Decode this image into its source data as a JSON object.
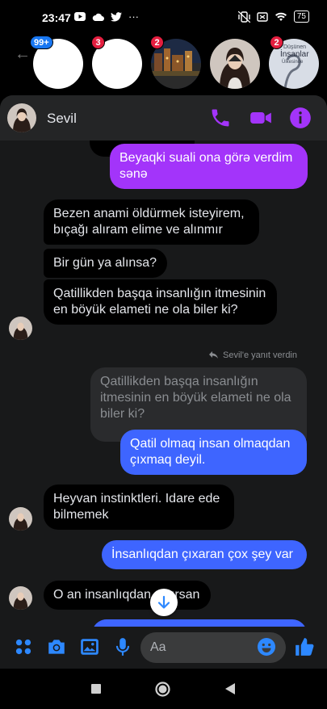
{
  "status_bar": {
    "time": "23:47",
    "dots": "···",
    "battery": "75"
  },
  "chat_heads": [
    {
      "badge": "99+",
      "badge_color": "#1877f2"
    },
    {
      "badge": "3",
      "badge_color": "#e41e3f"
    },
    {
      "badge": "2",
      "badge_color": "#e41e3f"
    },
    {
      "badge": "",
      "badge_color": ""
    },
    {
      "badge": "2",
      "badge_color": "#e41e3f",
      "art_text": [
        "Düşünen",
        "İnsanlar",
        "Ülkesinde"
      ]
    }
  ],
  "header": {
    "name": "Sevil"
  },
  "colors": {
    "accent": "#a334fa",
    "blue_bubble": "#3e65ff",
    "purple_bubble": "#a334fa",
    "icon_blue": "#2d88ff"
  },
  "messages": {
    "m0": "Beyaqki suali ona görə verdim sənə",
    "m1": "Bezen anami öldürmek isteyirem, bıçağı alıram elime ve alınmır",
    "m2": "Bir gün ya alınsa?",
    "m3": "Qatillikden başqa insanlığın itmesinin en böyük elameti ne ola biler ki?",
    "reply_note": "Sevil'e yanıt verdin",
    "m4_quoted": "Qatillikden başqa insanlığın itmesinin en böyük elameti ne ola biler ki?",
    "m5": "Qatil olmaq insan olmaqdan çıxmaq deyil.",
    "m6": "Heyvan instinktleri. Idare ede bilmemek",
    "m7": "İnsanlıqdan çıxaran çox şey var",
    "m8": "O an insanlıqdan çıxırsan"
  },
  "composer": {
    "placeholder": "Aa"
  }
}
